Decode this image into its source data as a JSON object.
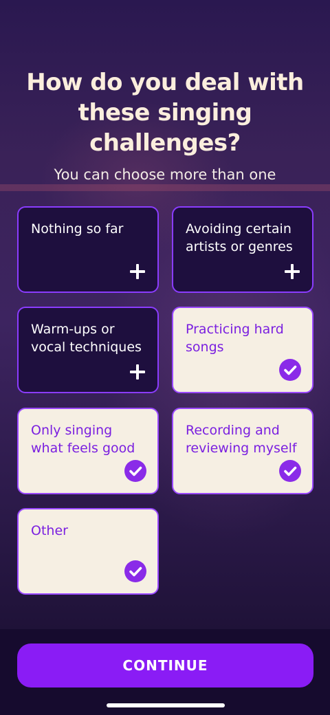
{
  "header": {
    "title": "How do you deal with these singing challenges?",
    "subtitle": "You can choose more than one"
  },
  "options": [
    {
      "label": "Nothing so far",
      "selected": false
    },
    {
      "label": "Avoiding certain artists or genres",
      "selected": false
    },
    {
      "label": "Warm-ups or vocal techniques",
      "selected": false
    },
    {
      "label": "Practicing hard songs",
      "selected": true
    },
    {
      "label": "Only singing what feels good",
      "selected": true
    },
    {
      "label": "Recording and reviewing myself",
      "selected": true
    },
    {
      "label": "Other",
      "selected": true
    }
  ],
  "footer": {
    "continue_label": "CONTINUE"
  },
  "icons": {
    "unselected": "plus-icon",
    "selected": "checkmark-circle-icon"
  },
  "colors": {
    "accent": "#8a1cf5",
    "card_dark": "#1e0f3e",
    "card_selected": "#f6efe3",
    "selected_text": "#7a1fe0",
    "title_text": "#fbeedd"
  }
}
